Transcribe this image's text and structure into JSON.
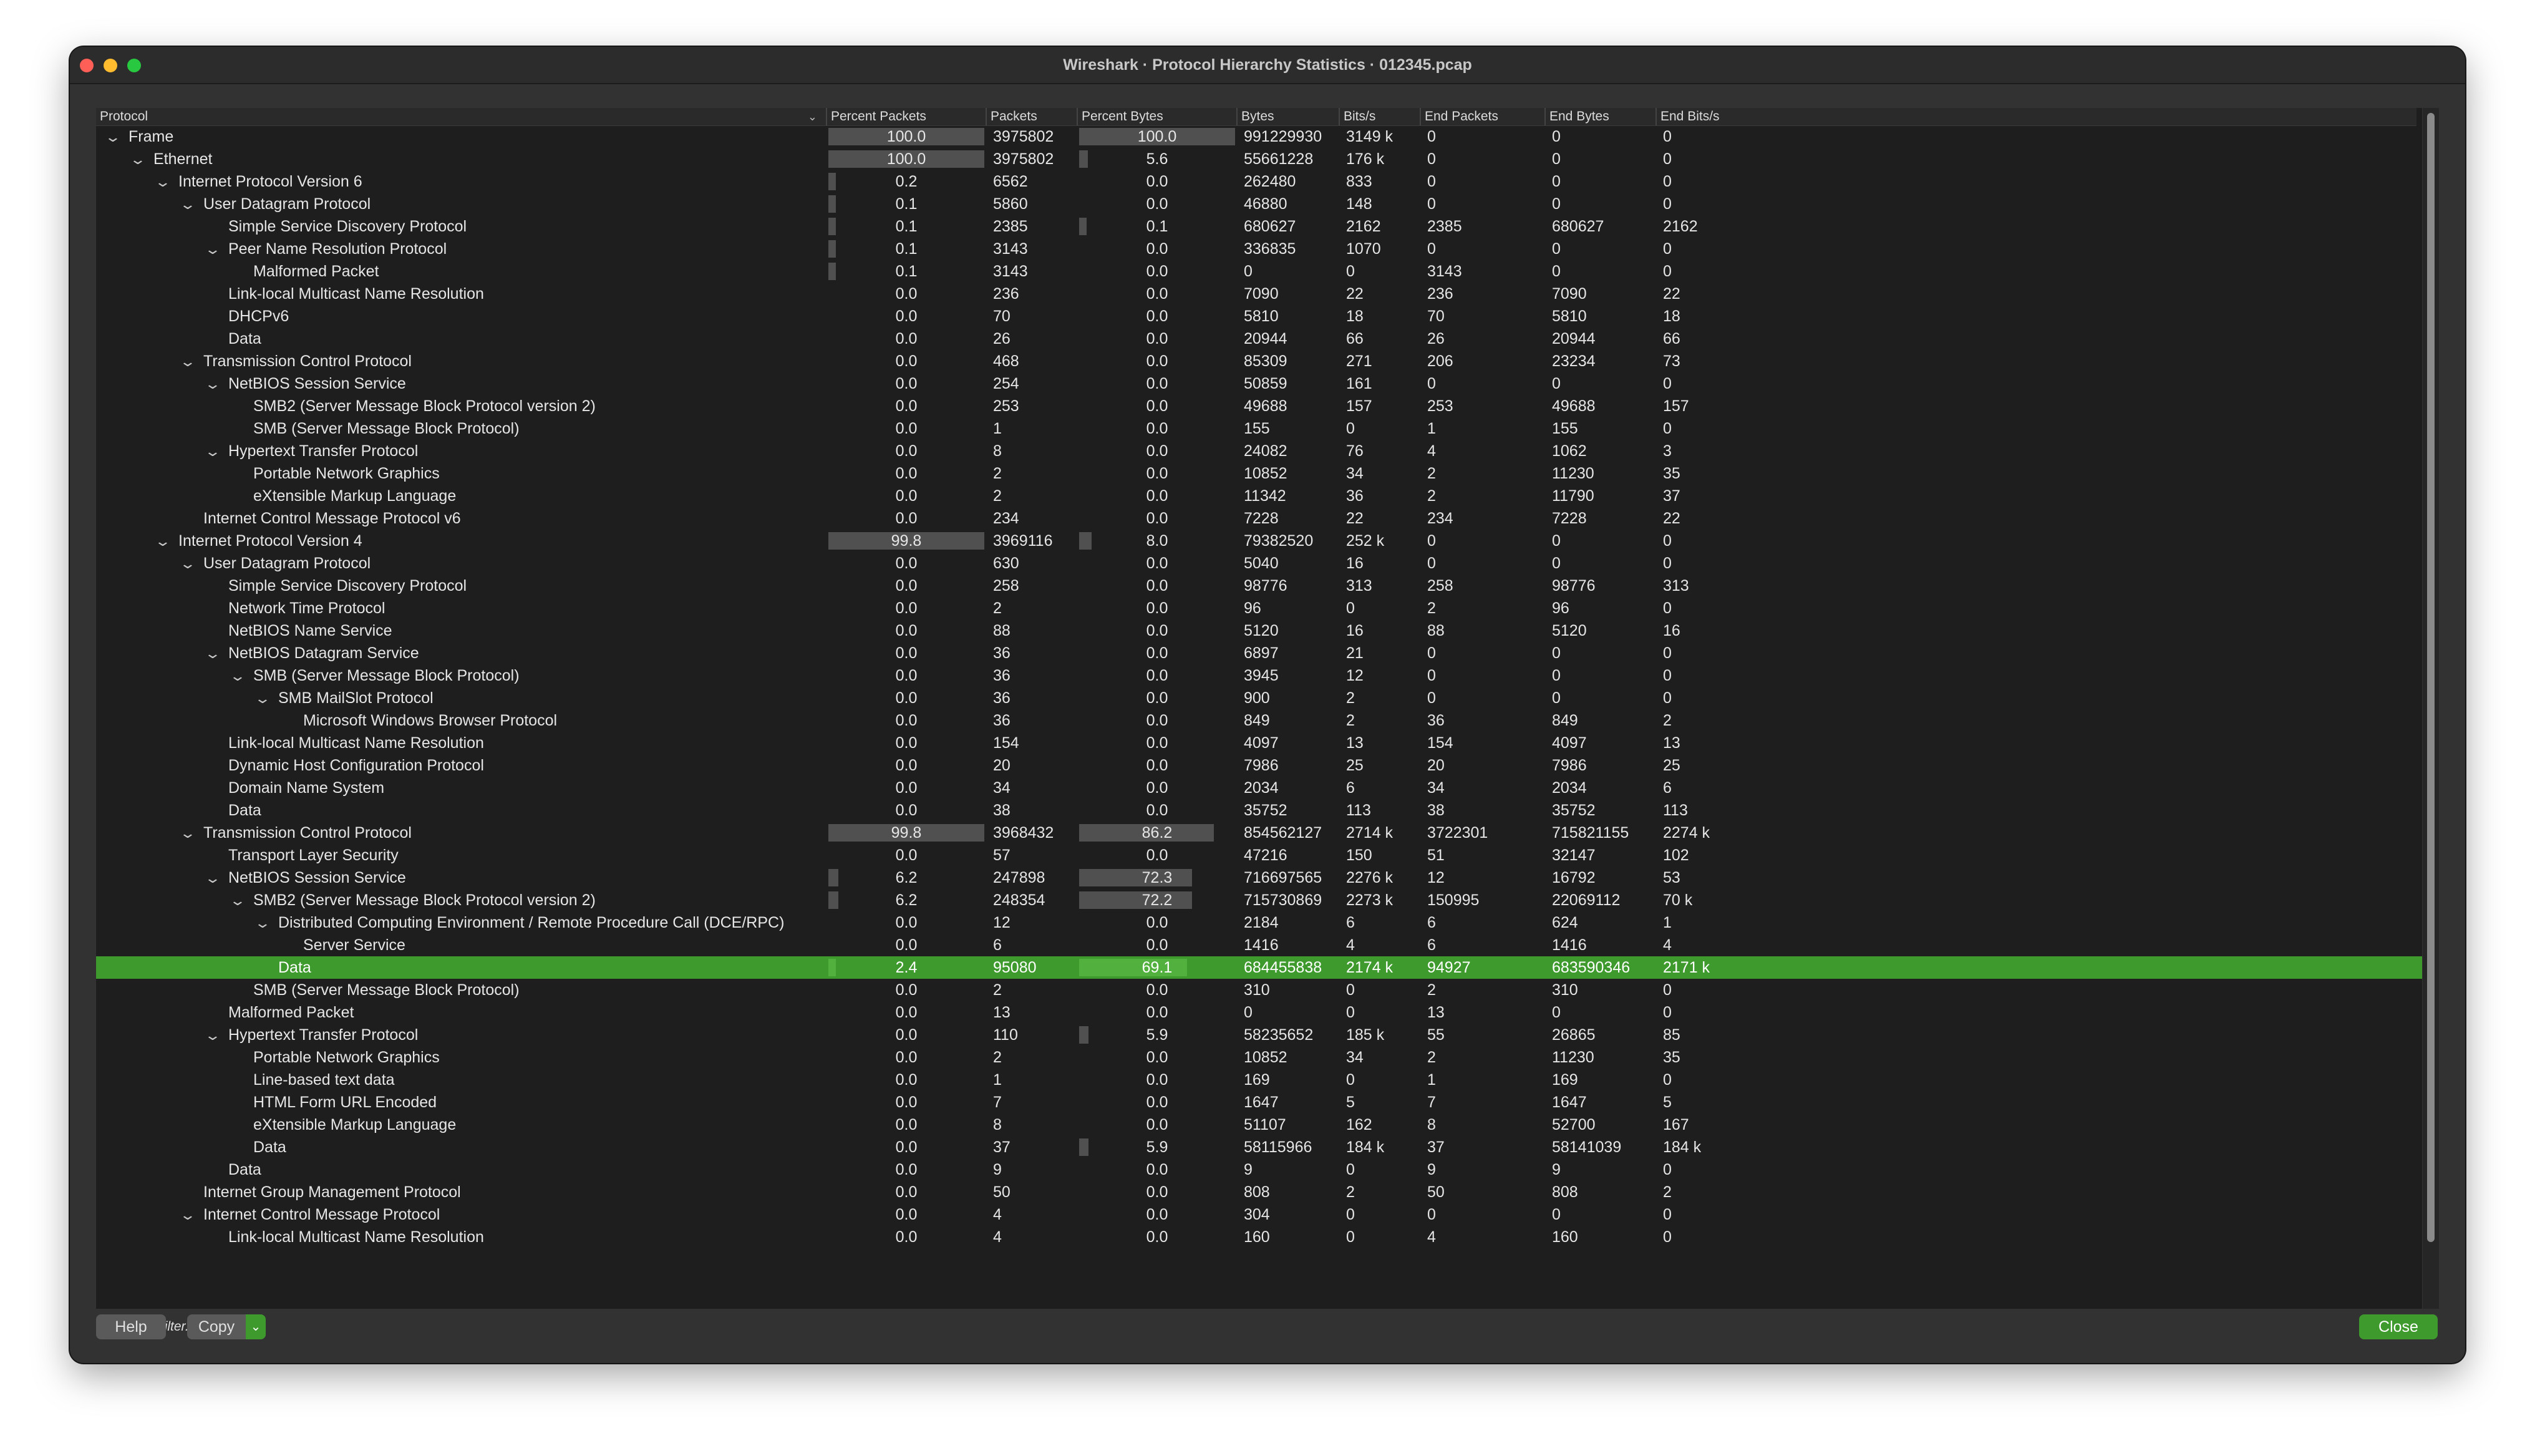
{
  "window_title": "Wireshark · Protocol Hierarchy Statistics · 012345.pcap",
  "columns": [
    "Protocol",
    "Percent Packets",
    "Packets",
    "Percent Bytes",
    "Bytes",
    "Bits/s",
    "End Packets",
    "End Bytes",
    "End Bits/s"
  ],
  "sort_indicator_icon": "chevron-down-icon",
  "colors": {
    "selection": "#3f9a2e",
    "bar": "#505050",
    "accent_button": "#3f9a2e"
  },
  "rows": [
    {
      "name": "Frame",
      "depth": 0,
      "expanded": true,
      "pp": "100.0",
      "pp_val": 100.0,
      "packets": "3975802",
      "pb": "100.0",
      "pb_val": 100.0,
      "bytes": "991229930",
      "bits": "3149 k",
      "ep": "0",
      "eb": "0",
      "ebits": "0"
    },
    {
      "name": "Ethernet",
      "depth": 1,
      "expanded": true,
      "pp": "100.0",
      "pp_val": 100.0,
      "packets": "3975802",
      "pb": "5.6",
      "pb_val": 5.6,
      "bytes": "55661228",
      "bits": "176 k",
      "ep": "0",
      "eb": "0",
      "ebits": "0"
    },
    {
      "name": "Internet Protocol Version 6",
      "depth": 2,
      "expanded": true,
      "pp": "0.2",
      "pp_val": 0.2,
      "packets": "6562",
      "pb": "0.0",
      "pb_val": 0.0,
      "bytes": "262480",
      "bits": "833",
      "ep": "0",
      "eb": "0",
      "ebits": "0"
    },
    {
      "name": "User Datagram Protocol",
      "depth": 3,
      "expanded": true,
      "pp": "0.1",
      "pp_val": 0.1,
      "packets": "5860",
      "pb": "0.0",
      "pb_val": 0.0,
      "bytes": "46880",
      "bits": "148",
      "ep": "0",
      "eb": "0",
      "ebits": "0"
    },
    {
      "name": "Simple Service Discovery Protocol",
      "depth": 4,
      "expanded": false,
      "pp": "0.1",
      "pp_val": 0.1,
      "packets": "2385",
      "pb": "0.1",
      "pb_val": 0.1,
      "bytes": "680627",
      "bits": "2162",
      "ep": "2385",
      "eb": "680627",
      "ebits": "2162"
    },
    {
      "name": "Peer Name Resolution Protocol",
      "depth": 4,
      "expanded": true,
      "pp": "0.1",
      "pp_val": 0.1,
      "packets": "3143",
      "pb": "0.0",
      "pb_val": 0.0,
      "bytes": "336835",
      "bits": "1070",
      "ep": "0",
      "eb": "0",
      "ebits": "0"
    },
    {
      "name": "Malformed Packet",
      "depth": 5,
      "expanded": false,
      "pp": "0.1",
      "pp_val": 0.1,
      "packets": "3143",
      "pb": "0.0",
      "pb_val": 0.0,
      "bytes": "0",
      "bits": "0",
      "ep": "3143",
      "eb": "0",
      "ebits": "0"
    },
    {
      "name": "Link-local Multicast Name Resolution",
      "depth": 4,
      "expanded": false,
      "pp": "0.0",
      "pp_val": 0.0,
      "packets": "236",
      "pb": "0.0",
      "pb_val": 0.0,
      "bytes": "7090",
      "bits": "22",
      "ep": "236",
      "eb": "7090",
      "ebits": "22"
    },
    {
      "name": "DHCPv6",
      "depth": 4,
      "expanded": false,
      "pp": "0.0",
      "pp_val": 0.0,
      "packets": "70",
      "pb": "0.0",
      "pb_val": 0.0,
      "bytes": "5810",
      "bits": "18",
      "ep": "70",
      "eb": "5810",
      "ebits": "18"
    },
    {
      "name": "Data",
      "depth": 4,
      "expanded": false,
      "pp": "0.0",
      "pp_val": 0.0,
      "packets": "26",
      "pb": "0.0",
      "pb_val": 0.0,
      "bytes": "20944",
      "bits": "66",
      "ep": "26",
      "eb": "20944",
      "ebits": "66"
    },
    {
      "name": "Transmission Control Protocol",
      "depth": 3,
      "expanded": true,
      "pp": "0.0",
      "pp_val": 0.0,
      "packets": "468",
      "pb": "0.0",
      "pb_val": 0.0,
      "bytes": "85309",
      "bits": "271",
      "ep": "206",
      "eb": "23234",
      "ebits": "73"
    },
    {
      "name": "NetBIOS Session Service",
      "depth": 4,
      "expanded": true,
      "pp": "0.0",
      "pp_val": 0.0,
      "packets": "254",
      "pb": "0.0",
      "pb_val": 0.0,
      "bytes": "50859",
      "bits": "161",
      "ep": "0",
      "eb": "0",
      "ebits": "0"
    },
    {
      "name": "SMB2 (Server Message Block Protocol version 2)",
      "depth": 5,
      "expanded": false,
      "pp": "0.0",
      "pp_val": 0.0,
      "packets": "253",
      "pb": "0.0",
      "pb_val": 0.0,
      "bytes": "49688",
      "bits": "157",
      "ep": "253",
      "eb": "49688",
      "ebits": "157"
    },
    {
      "name": "SMB (Server Message Block Protocol)",
      "depth": 5,
      "expanded": false,
      "pp": "0.0",
      "pp_val": 0.0,
      "packets": "1",
      "pb": "0.0",
      "pb_val": 0.0,
      "bytes": "155",
      "bits": "0",
      "ep": "1",
      "eb": "155",
      "ebits": "0"
    },
    {
      "name": "Hypertext Transfer Protocol",
      "depth": 4,
      "expanded": true,
      "pp": "0.0",
      "pp_val": 0.0,
      "packets": "8",
      "pb": "0.0",
      "pb_val": 0.0,
      "bytes": "24082",
      "bits": "76",
      "ep": "4",
      "eb": "1062",
      "ebits": "3"
    },
    {
      "name": "Portable Network Graphics",
      "depth": 5,
      "expanded": false,
      "pp": "0.0",
      "pp_val": 0.0,
      "packets": "2",
      "pb": "0.0",
      "pb_val": 0.0,
      "bytes": "10852",
      "bits": "34",
      "ep": "2",
      "eb": "11230",
      "ebits": "35"
    },
    {
      "name": "eXtensible Markup Language",
      "depth": 5,
      "expanded": false,
      "pp": "0.0",
      "pp_val": 0.0,
      "packets": "2",
      "pb": "0.0",
      "pb_val": 0.0,
      "bytes": "11342",
      "bits": "36",
      "ep": "2",
      "eb": "11790",
      "ebits": "37"
    },
    {
      "name": "Internet Control Message Protocol v6",
      "depth": 3,
      "expanded": false,
      "pp": "0.0",
      "pp_val": 0.0,
      "packets": "234",
      "pb": "0.0",
      "pb_val": 0.0,
      "bytes": "7228",
      "bits": "22",
      "ep": "234",
      "eb": "7228",
      "ebits": "22"
    },
    {
      "name": "Internet Protocol Version 4",
      "depth": 2,
      "expanded": true,
      "pp": "99.8",
      "pp_val": 99.8,
      "packets": "3969116",
      "pb": "8.0",
      "pb_val": 8.0,
      "bytes": "79382520",
      "bits": "252 k",
      "ep": "0",
      "eb": "0",
      "ebits": "0"
    },
    {
      "name": "User Datagram Protocol",
      "depth": 3,
      "expanded": true,
      "pp": "0.0",
      "pp_val": 0.0,
      "packets": "630",
      "pb": "0.0",
      "pb_val": 0.0,
      "bytes": "5040",
      "bits": "16",
      "ep": "0",
      "eb": "0",
      "ebits": "0"
    },
    {
      "name": "Simple Service Discovery Protocol",
      "depth": 4,
      "expanded": false,
      "pp": "0.0",
      "pp_val": 0.0,
      "packets": "258",
      "pb": "0.0",
      "pb_val": 0.0,
      "bytes": "98776",
      "bits": "313",
      "ep": "258",
      "eb": "98776",
      "ebits": "313"
    },
    {
      "name": "Network Time Protocol",
      "depth": 4,
      "expanded": false,
      "pp": "0.0",
      "pp_val": 0.0,
      "packets": "2",
      "pb": "0.0",
      "pb_val": 0.0,
      "bytes": "96",
      "bits": "0",
      "ep": "2",
      "eb": "96",
      "ebits": "0"
    },
    {
      "name": "NetBIOS Name Service",
      "depth": 4,
      "expanded": false,
      "pp": "0.0",
      "pp_val": 0.0,
      "packets": "88",
      "pb": "0.0",
      "pb_val": 0.0,
      "bytes": "5120",
      "bits": "16",
      "ep": "88",
      "eb": "5120",
      "ebits": "16"
    },
    {
      "name": "NetBIOS Datagram Service",
      "depth": 4,
      "expanded": true,
      "pp": "0.0",
      "pp_val": 0.0,
      "packets": "36",
      "pb": "0.0",
      "pb_val": 0.0,
      "bytes": "6897",
      "bits": "21",
      "ep": "0",
      "eb": "0",
      "ebits": "0"
    },
    {
      "name": "SMB (Server Message Block Protocol)",
      "depth": 5,
      "expanded": true,
      "pp": "0.0",
      "pp_val": 0.0,
      "packets": "36",
      "pb": "0.0",
      "pb_val": 0.0,
      "bytes": "3945",
      "bits": "12",
      "ep": "0",
      "eb": "0",
      "ebits": "0"
    },
    {
      "name": "SMB MailSlot Protocol",
      "depth": 6,
      "expanded": true,
      "pp": "0.0",
      "pp_val": 0.0,
      "packets": "36",
      "pb": "0.0",
      "pb_val": 0.0,
      "bytes": "900",
      "bits": "2",
      "ep": "0",
      "eb": "0",
      "ebits": "0"
    },
    {
      "name": "Microsoft Windows Browser Protocol",
      "depth": 7,
      "expanded": false,
      "pp": "0.0",
      "pp_val": 0.0,
      "packets": "36",
      "pb": "0.0",
      "pb_val": 0.0,
      "bytes": "849",
      "bits": "2",
      "ep": "36",
      "eb": "849",
      "ebits": "2"
    },
    {
      "name": "Link-local Multicast Name Resolution",
      "depth": 4,
      "expanded": false,
      "pp": "0.0",
      "pp_val": 0.0,
      "packets": "154",
      "pb": "0.0",
      "pb_val": 0.0,
      "bytes": "4097",
      "bits": "13",
      "ep": "154",
      "eb": "4097",
      "ebits": "13"
    },
    {
      "name": "Dynamic Host Configuration Protocol",
      "depth": 4,
      "expanded": false,
      "pp": "0.0",
      "pp_val": 0.0,
      "packets": "20",
      "pb": "0.0",
      "pb_val": 0.0,
      "bytes": "7986",
      "bits": "25",
      "ep": "20",
      "eb": "7986",
      "ebits": "25"
    },
    {
      "name": "Domain Name System",
      "depth": 4,
      "expanded": false,
      "pp": "0.0",
      "pp_val": 0.0,
      "packets": "34",
      "pb": "0.0",
      "pb_val": 0.0,
      "bytes": "2034",
      "bits": "6",
      "ep": "34",
      "eb": "2034",
      "ebits": "6"
    },
    {
      "name": "Data",
      "depth": 4,
      "expanded": false,
      "pp": "0.0",
      "pp_val": 0.0,
      "packets": "38",
      "pb": "0.0",
      "pb_val": 0.0,
      "bytes": "35752",
      "bits": "113",
      "ep": "38",
      "eb": "35752",
      "ebits": "113"
    },
    {
      "name": "Transmission Control Protocol",
      "depth": 3,
      "expanded": true,
      "pp": "99.8",
      "pp_val": 99.8,
      "packets": "3968432",
      "pb": "86.2",
      "pb_val": 86.2,
      "bytes": "854562127",
      "bits": "2714 k",
      "ep": "3722301",
      "eb": "715821155",
      "ebits": "2274 k"
    },
    {
      "name": "Transport Layer Security",
      "depth": 4,
      "expanded": false,
      "pp": "0.0",
      "pp_val": 0.0,
      "packets": "57",
      "pb": "0.0",
      "pb_val": 0.0,
      "bytes": "47216",
      "bits": "150",
      "ep": "51",
      "eb": "32147",
      "ebits": "102"
    },
    {
      "name": "NetBIOS Session Service",
      "depth": 4,
      "expanded": true,
      "pp": "6.2",
      "pp_val": 6.2,
      "packets": "247898",
      "pb": "72.3",
      "pb_val": 72.3,
      "bytes": "716697565",
      "bits": "2276 k",
      "ep": "12",
      "eb": "16792",
      "ebits": "53"
    },
    {
      "name": "SMB2 (Server Message Block Protocol version 2)",
      "depth": 5,
      "expanded": true,
      "pp": "6.2",
      "pp_val": 6.2,
      "packets": "248354",
      "pb": "72.2",
      "pb_val": 72.2,
      "bytes": "715730869",
      "bits": "2273 k",
      "ep": "150995",
      "eb": "22069112",
      "ebits": "70 k"
    },
    {
      "name": "Distributed Computing Environment / Remote Procedure Call (DCE/RPC)",
      "depth": 6,
      "expanded": true,
      "pp": "0.0",
      "pp_val": 0.0,
      "packets": "12",
      "pb": "0.0",
      "pb_val": 0.0,
      "bytes": "2184",
      "bits": "6",
      "ep": "6",
      "eb": "624",
      "ebits": "1"
    },
    {
      "name": "Server Service",
      "depth": 7,
      "expanded": false,
      "pp": "0.0",
      "pp_val": 0.0,
      "packets": "6",
      "pb": "0.0",
      "pb_val": 0.0,
      "bytes": "1416",
      "bits": "4",
      "ep": "6",
      "eb": "1416",
      "ebits": "4"
    },
    {
      "name": "Data",
      "depth": 6,
      "expanded": false,
      "selected": true,
      "pp": "2.4",
      "pp_val": 2.4,
      "packets": "95080",
      "pb": "69.1",
      "pb_val": 69.1,
      "bytes": "684455838",
      "bits": "2174 k",
      "ep": "94927",
      "eb": "683590346",
      "ebits": "2171 k"
    },
    {
      "name": "SMB (Server Message Block Protocol)",
      "depth": 5,
      "expanded": false,
      "pp": "0.0",
      "pp_val": 0.0,
      "packets": "2",
      "pb": "0.0",
      "pb_val": 0.0,
      "bytes": "310",
      "bits": "0",
      "ep": "2",
      "eb": "310",
      "ebits": "0"
    },
    {
      "name": "Malformed Packet",
      "depth": 4,
      "expanded": false,
      "pp": "0.0",
      "pp_val": 0.0,
      "packets": "13",
      "pb": "0.0",
      "pb_val": 0.0,
      "bytes": "0",
      "bits": "0",
      "ep": "13",
      "eb": "0",
      "ebits": "0"
    },
    {
      "name": "Hypertext Transfer Protocol",
      "depth": 4,
      "expanded": true,
      "pp": "0.0",
      "pp_val": 0.0,
      "packets": "110",
      "pb": "5.9",
      "pb_val": 5.9,
      "bytes": "58235652",
      "bits": "185 k",
      "ep": "55",
      "eb": "26865",
      "ebits": "85"
    },
    {
      "name": "Portable Network Graphics",
      "depth": 5,
      "expanded": false,
      "pp": "0.0",
      "pp_val": 0.0,
      "packets": "2",
      "pb": "0.0",
      "pb_val": 0.0,
      "bytes": "10852",
      "bits": "34",
      "ep": "2",
      "eb": "11230",
      "ebits": "35"
    },
    {
      "name": "Line-based text data",
      "depth": 5,
      "expanded": false,
      "pp": "0.0",
      "pp_val": 0.0,
      "packets": "1",
      "pb": "0.0",
      "pb_val": 0.0,
      "bytes": "169",
      "bits": "0",
      "ep": "1",
      "eb": "169",
      "ebits": "0"
    },
    {
      "name": "HTML Form URL Encoded",
      "depth": 5,
      "expanded": false,
      "pp": "0.0",
      "pp_val": 0.0,
      "packets": "7",
      "pb": "0.0",
      "pb_val": 0.0,
      "bytes": "1647",
      "bits": "5",
      "ep": "7",
      "eb": "1647",
      "ebits": "5"
    },
    {
      "name": "eXtensible Markup Language",
      "depth": 5,
      "expanded": false,
      "pp": "0.0",
      "pp_val": 0.0,
      "packets": "8",
      "pb": "0.0",
      "pb_val": 0.0,
      "bytes": "51107",
      "bits": "162",
      "ep": "8",
      "eb": "52700",
      "ebits": "167"
    },
    {
      "name": "Data",
      "depth": 5,
      "expanded": false,
      "pp": "0.0",
      "pp_val": 0.0,
      "packets": "37",
      "pb": "5.9",
      "pb_val": 5.9,
      "bytes": "58115966",
      "bits": "184 k",
      "ep": "37",
      "eb": "58141039",
      "ebits": "184 k"
    },
    {
      "name": "Data",
      "depth": 4,
      "expanded": false,
      "pp": "0.0",
      "pp_val": 0.0,
      "packets": "9",
      "pb": "0.0",
      "pb_val": 0.0,
      "bytes": "9",
      "bits": "0",
      "ep": "9",
      "eb": "9",
      "ebits": "0"
    },
    {
      "name": "Internet Group Management Protocol",
      "depth": 3,
      "expanded": false,
      "pp": "0.0",
      "pp_val": 0.0,
      "packets": "50",
      "pb": "0.0",
      "pb_val": 0.0,
      "bytes": "808",
      "bits": "2",
      "ep": "50",
      "eb": "808",
      "ebits": "2"
    },
    {
      "name": "Internet Control Message Protocol",
      "depth": 3,
      "expanded": true,
      "pp": "0.0",
      "pp_val": 0.0,
      "packets": "4",
      "pb": "0.0",
      "pb_val": 0.0,
      "bytes": "304",
      "bits": "0",
      "ep": "0",
      "eb": "0",
      "ebits": "0"
    },
    {
      "name": "Link-local Multicast Name Resolution",
      "depth": 4,
      "expanded": false,
      "pp": "0.0",
      "pp_val": 0.0,
      "packets": "4",
      "pb": "0.0",
      "pb_val": 0.0,
      "bytes": "160",
      "bits": "0",
      "ep": "4",
      "eb": "160",
      "ebits": "0"
    }
  ],
  "footer": {
    "filter_status": "No display filter.",
    "help_label": "Help",
    "copy_label": "Copy",
    "close_label": "Close"
  }
}
